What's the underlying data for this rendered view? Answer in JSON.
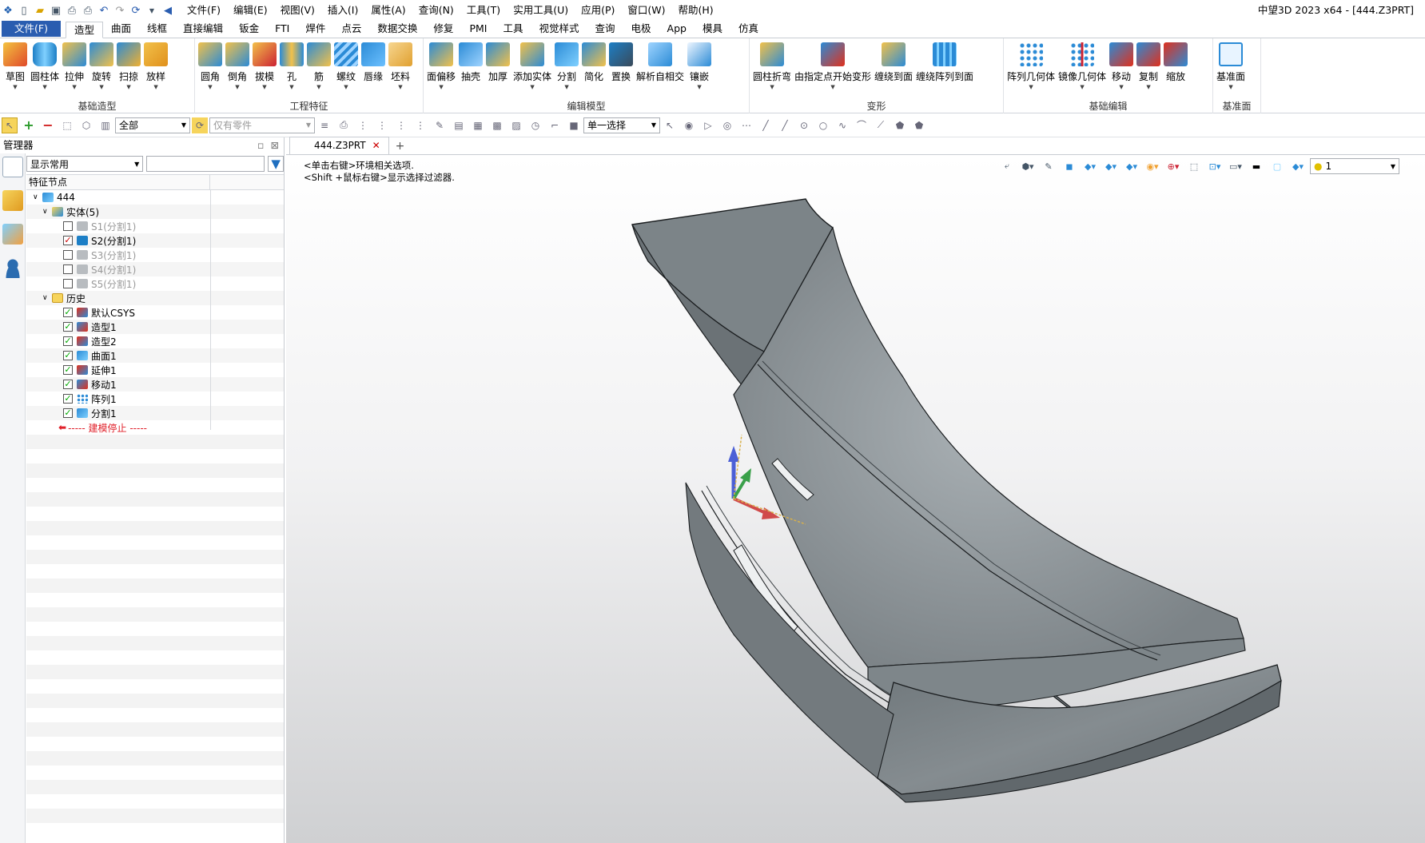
{
  "window": {
    "title": "中望3D 2023 x64 - [444.Z3PRT]"
  },
  "menu": [
    "文件(F)",
    "编辑(E)",
    "视图(V)",
    "插入(I)",
    "属性(A)",
    "查询(N)",
    "工具(T)",
    "实用工具(U)",
    "应用(P)",
    "窗口(W)",
    "帮助(H)"
  ],
  "ribbon_tabs": {
    "file": "文件(F)",
    "tabs": [
      "造型",
      "曲面",
      "线框",
      "直接编辑",
      "钣金",
      "FTI",
      "焊件",
      "点云",
      "数据交换",
      "修复",
      "PMI",
      "工具",
      "视觉样式",
      "查询",
      "电极",
      "App",
      "模具",
      "仿真"
    ],
    "active": "造型"
  },
  "ribbon_groups": [
    {
      "label": "基础造型",
      "buttons": [
        "草图",
        "圆柱体",
        "拉伸",
        "旋转",
        "扫掠",
        "放样"
      ]
    },
    {
      "label": "工程特征",
      "buttons": [
        "圆角",
        "倒角",
        "拔模",
        "孔",
        "筋",
        "螺纹",
        "唇缘",
        "坯料"
      ]
    },
    {
      "label": "编辑模型",
      "buttons": [
        "面偏移",
        "抽壳",
        "加厚",
        "添加实体",
        "分割",
        "简化",
        "置换",
        "解析自相交",
        "镶嵌"
      ]
    },
    {
      "label": "变形",
      "buttons": [
        "圆柱折弯",
        "由指定点开始变形",
        "缠绕到面",
        "缠绕阵列到面"
      ]
    },
    {
      "label": "基础编辑",
      "buttons": [
        "阵列几何体",
        "镜像几何体",
        "移动",
        "复制",
        "缩放"
      ]
    },
    {
      "label": "基准面",
      "buttons": [
        "基准面"
      ]
    }
  ],
  "toolbar2": {
    "filter_value": "全部",
    "part_filter": "仅有零件",
    "select_mode": "单一选择"
  },
  "manager": {
    "title": "管理器",
    "display_filter": "显示常用",
    "search_placeholder": "",
    "column_header": "特征节点",
    "tree": {
      "root": "444",
      "solids_label": "实体(5)",
      "solids": [
        {
          "label": "S1(分割1)",
          "checked": false,
          "active": false
        },
        {
          "label": "S2(分割1)",
          "checked": true,
          "active": true
        },
        {
          "label": "S3(分割1)",
          "checked": false,
          "active": false
        },
        {
          "label": "S4(分割1)",
          "checked": false,
          "active": false
        },
        {
          "label": "S5(分割1)",
          "checked": false,
          "active": false
        }
      ],
      "history_label": "历史",
      "history": [
        "默认CSYS",
        "造型1",
        "造型2",
        "曲面1",
        "延伸1",
        "移动1",
        "阵列1",
        "分割1"
      ],
      "stop_label": "----- 建模停止 -----"
    }
  },
  "document": {
    "tab": "444.Z3PRT",
    "new_tab": "+"
  },
  "hints": [
    "<单击右键>环境相关选项.",
    "<Shift +鼠标右键>显示选择过滤器."
  ],
  "view_toolbar": {
    "layer_value": "1"
  },
  "colors": {
    "accent": "#2a5db0",
    "model": "#7e868a",
    "stop": "#e0202a"
  }
}
